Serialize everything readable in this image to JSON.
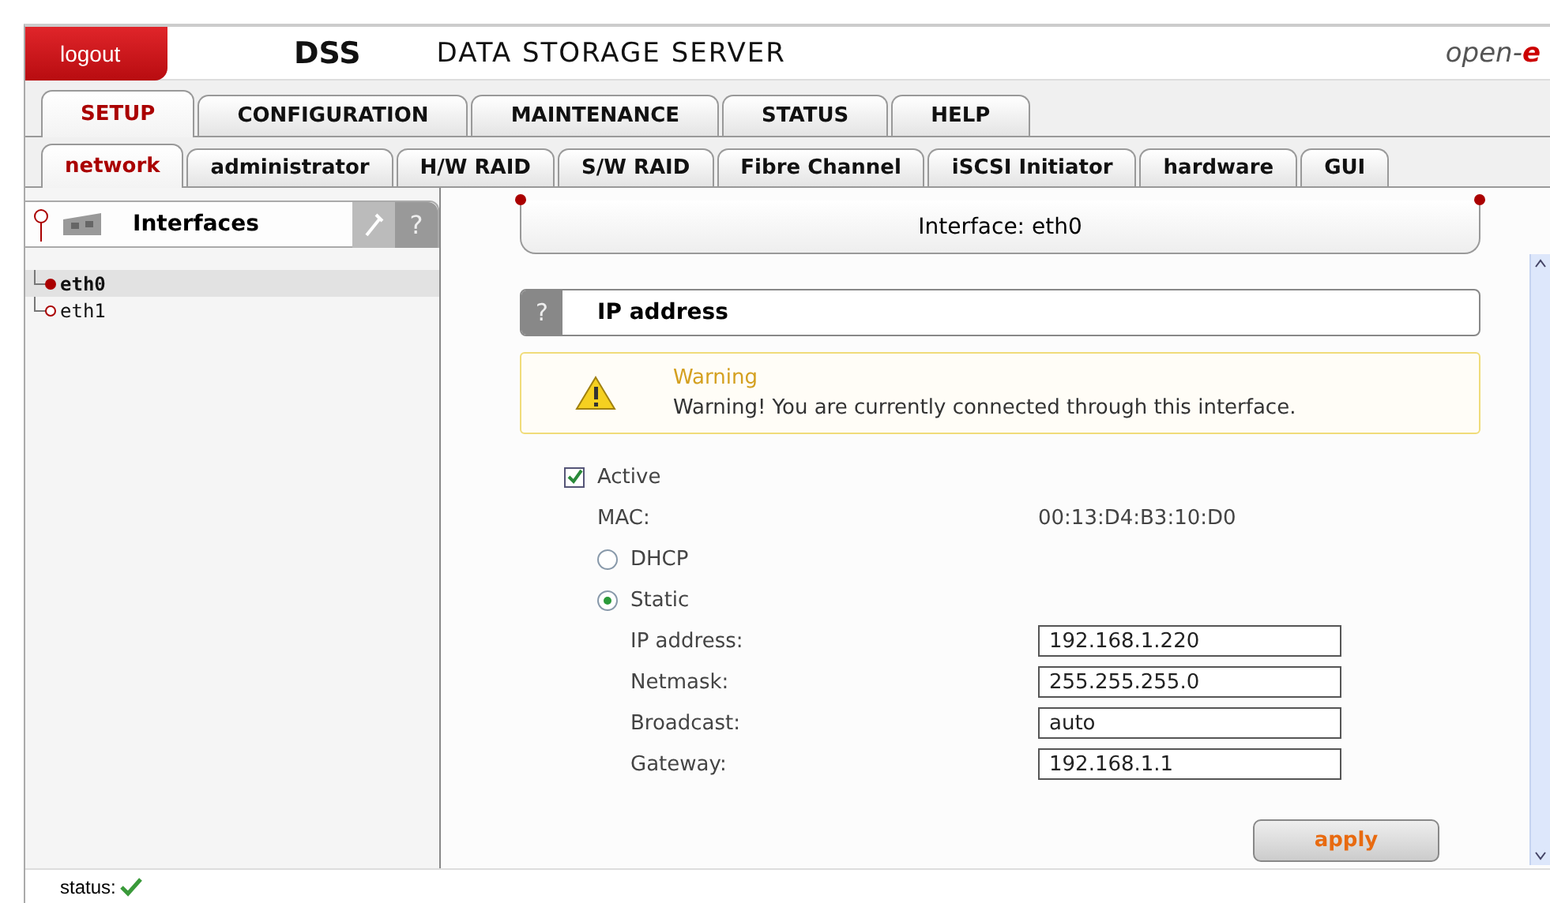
{
  "header": {
    "logout": "logout",
    "product": "DSS",
    "title": "DATA STORAGE SERVER",
    "brand_prefix": "open-",
    "brand_suffix": "e"
  },
  "main_tabs": [
    {
      "label": "SETUP",
      "selected": true
    },
    {
      "label": "CONFIGURATION",
      "selected": false
    },
    {
      "label": "MAINTENANCE",
      "selected": false
    },
    {
      "label": "STATUS",
      "selected": false
    },
    {
      "label": "HELP",
      "selected": false
    }
  ],
  "sub_tabs": [
    {
      "label": "network",
      "selected": true
    },
    {
      "label": "administrator",
      "selected": false
    },
    {
      "label": "H/W RAID",
      "selected": false
    },
    {
      "label": "S/W RAID",
      "selected": false
    },
    {
      "label": "Fibre Channel",
      "selected": false
    },
    {
      "label": "iSCSI Initiator",
      "selected": false
    },
    {
      "label": "hardware",
      "selected": false
    },
    {
      "label": "GUI",
      "selected": false
    }
  ],
  "sidebar": {
    "title": "Interfaces",
    "help": "?",
    "items": [
      {
        "label": "eth0",
        "selected": true
      },
      {
        "label": "eth1",
        "selected": false
      }
    ]
  },
  "content": {
    "title": "Interface: eth0",
    "section": {
      "help": "?",
      "title": "IP address"
    },
    "warning": {
      "title": "Warning",
      "message": "Warning! You are currently connected through this interface."
    },
    "active": {
      "label": "Active",
      "checked": true
    },
    "mac": {
      "label": "MAC:",
      "value": "00:13:D4:B3:10:D0"
    },
    "modes": [
      {
        "label": "DHCP",
        "selected": false
      },
      {
        "label": "Static",
        "selected": true
      }
    ],
    "fields": [
      {
        "label": "IP address:",
        "value": "192.168.1.220"
      },
      {
        "label": "Netmask:",
        "value": "255.255.255.0"
      },
      {
        "label": "Broadcast:",
        "value": "auto"
      },
      {
        "label": "Gateway:",
        "value": "192.168.1.1"
      }
    ],
    "apply": "apply"
  },
  "status_bar": {
    "label": "status:",
    "ok": true
  }
}
